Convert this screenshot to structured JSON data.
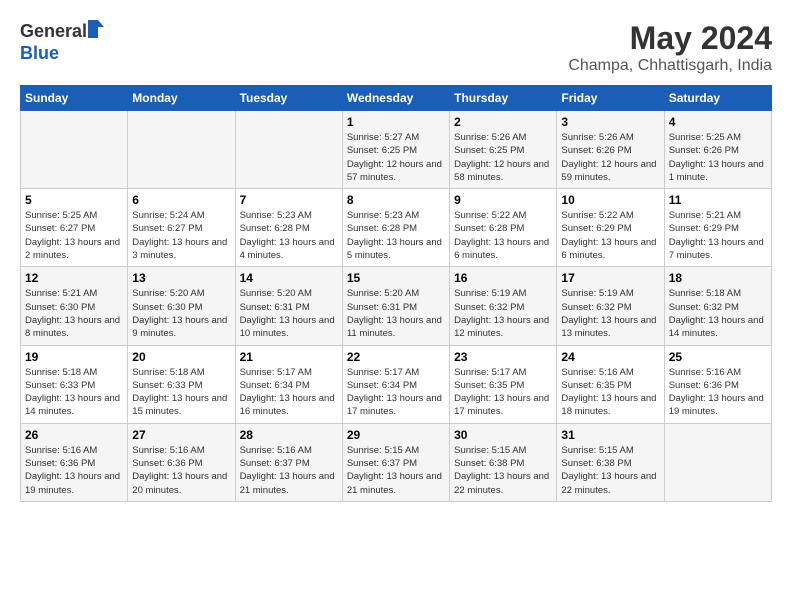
{
  "logo": {
    "general": "General",
    "blue": "Blue"
  },
  "title": {
    "month_year": "May 2024",
    "location": "Champa, Chhattisgarh, India"
  },
  "days_of_week": [
    "Sunday",
    "Monday",
    "Tuesday",
    "Wednesday",
    "Thursday",
    "Friday",
    "Saturday"
  ],
  "weeks": [
    [
      {
        "num": "",
        "sunrise": "",
        "sunset": "",
        "daylight": ""
      },
      {
        "num": "",
        "sunrise": "",
        "sunset": "",
        "daylight": ""
      },
      {
        "num": "",
        "sunrise": "",
        "sunset": "",
        "daylight": ""
      },
      {
        "num": "1",
        "sunrise": "Sunrise: 5:27 AM",
        "sunset": "Sunset: 6:25 PM",
        "daylight": "Daylight: 12 hours and 57 minutes."
      },
      {
        "num": "2",
        "sunrise": "Sunrise: 5:26 AM",
        "sunset": "Sunset: 6:25 PM",
        "daylight": "Daylight: 12 hours and 58 minutes."
      },
      {
        "num": "3",
        "sunrise": "Sunrise: 5:26 AM",
        "sunset": "Sunset: 6:26 PM",
        "daylight": "Daylight: 12 hours and 59 minutes."
      },
      {
        "num": "4",
        "sunrise": "Sunrise: 5:25 AM",
        "sunset": "Sunset: 6:26 PM",
        "daylight": "Daylight: 13 hours and 1 minute."
      }
    ],
    [
      {
        "num": "5",
        "sunrise": "Sunrise: 5:25 AM",
        "sunset": "Sunset: 6:27 PM",
        "daylight": "Daylight: 13 hours and 2 minutes."
      },
      {
        "num": "6",
        "sunrise": "Sunrise: 5:24 AM",
        "sunset": "Sunset: 6:27 PM",
        "daylight": "Daylight: 13 hours and 3 minutes."
      },
      {
        "num": "7",
        "sunrise": "Sunrise: 5:23 AM",
        "sunset": "Sunset: 6:28 PM",
        "daylight": "Daylight: 13 hours and 4 minutes."
      },
      {
        "num": "8",
        "sunrise": "Sunrise: 5:23 AM",
        "sunset": "Sunset: 6:28 PM",
        "daylight": "Daylight: 13 hours and 5 minutes."
      },
      {
        "num": "9",
        "sunrise": "Sunrise: 5:22 AM",
        "sunset": "Sunset: 6:28 PM",
        "daylight": "Daylight: 13 hours and 6 minutes."
      },
      {
        "num": "10",
        "sunrise": "Sunrise: 5:22 AM",
        "sunset": "Sunset: 6:29 PM",
        "daylight": "Daylight: 13 hours and 6 minutes."
      },
      {
        "num": "11",
        "sunrise": "Sunrise: 5:21 AM",
        "sunset": "Sunset: 6:29 PM",
        "daylight": "Daylight: 13 hours and 7 minutes."
      }
    ],
    [
      {
        "num": "12",
        "sunrise": "Sunrise: 5:21 AM",
        "sunset": "Sunset: 6:30 PM",
        "daylight": "Daylight: 13 hours and 8 minutes."
      },
      {
        "num": "13",
        "sunrise": "Sunrise: 5:20 AM",
        "sunset": "Sunset: 6:30 PM",
        "daylight": "Daylight: 13 hours and 9 minutes."
      },
      {
        "num": "14",
        "sunrise": "Sunrise: 5:20 AM",
        "sunset": "Sunset: 6:31 PM",
        "daylight": "Daylight: 13 hours and 10 minutes."
      },
      {
        "num": "15",
        "sunrise": "Sunrise: 5:20 AM",
        "sunset": "Sunset: 6:31 PM",
        "daylight": "Daylight: 13 hours and 11 minutes."
      },
      {
        "num": "16",
        "sunrise": "Sunrise: 5:19 AM",
        "sunset": "Sunset: 6:32 PM",
        "daylight": "Daylight: 13 hours and 12 minutes."
      },
      {
        "num": "17",
        "sunrise": "Sunrise: 5:19 AM",
        "sunset": "Sunset: 6:32 PM",
        "daylight": "Daylight: 13 hours and 13 minutes."
      },
      {
        "num": "18",
        "sunrise": "Sunrise: 5:18 AM",
        "sunset": "Sunset: 6:32 PM",
        "daylight": "Daylight: 13 hours and 14 minutes."
      }
    ],
    [
      {
        "num": "19",
        "sunrise": "Sunrise: 5:18 AM",
        "sunset": "Sunset: 6:33 PM",
        "daylight": "Daylight: 13 hours and 14 minutes."
      },
      {
        "num": "20",
        "sunrise": "Sunrise: 5:18 AM",
        "sunset": "Sunset: 6:33 PM",
        "daylight": "Daylight: 13 hours and 15 minutes."
      },
      {
        "num": "21",
        "sunrise": "Sunrise: 5:17 AM",
        "sunset": "Sunset: 6:34 PM",
        "daylight": "Daylight: 13 hours and 16 minutes."
      },
      {
        "num": "22",
        "sunrise": "Sunrise: 5:17 AM",
        "sunset": "Sunset: 6:34 PM",
        "daylight": "Daylight: 13 hours and 17 minutes."
      },
      {
        "num": "23",
        "sunrise": "Sunrise: 5:17 AM",
        "sunset": "Sunset: 6:35 PM",
        "daylight": "Daylight: 13 hours and 17 minutes."
      },
      {
        "num": "24",
        "sunrise": "Sunrise: 5:16 AM",
        "sunset": "Sunset: 6:35 PM",
        "daylight": "Daylight: 13 hours and 18 minutes."
      },
      {
        "num": "25",
        "sunrise": "Sunrise: 5:16 AM",
        "sunset": "Sunset: 6:36 PM",
        "daylight": "Daylight: 13 hours and 19 minutes."
      }
    ],
    [
      {
        "num": "26",
        "sunrise": "Sunrise: 5:16 AM",
        "sunset": "Sunset: 6:36 PM",
        "daylight": "Daylight: 13 hours and 19 minutes."
      },
      {
        "num": "27",
        "sunrise": "Sunrise: 5:16 AM",
        "sunset": "Sunset: 6:36 PM",
        "daylight": "Daylight: 13 hours and 20 minutes."
      },
      {
        "num": "28",
        "sunrise": "Sunrise: 5:16 AM",
        "sunset": "Sunset: 6:37 PM",
        "daylight": "Daylight: 13 hours and 21 minutes."
      },
      {
        "num": "29",
        "sunrise": "Sunrise: 5:15 AM",
        "sunset": "Sunset: 6:37 PM",
        "daylight": "Daylight: 13 hours and 21 minutes."
      },
      {
        "num": "30",
        "sunrise": "Sunrise: 5:15 AM",
        "sunset": "Sunset: 6:38 PM",
        "daylight": "Daylight: 13 hours and 22 minutes."
      },
      {
        "num": "31",
        "sunrise": "Sunrise: 5:15 AM",
        "sunset": "Sunset: 6:38 PM",
        "daylight": "Daylight: 13 hours and 22 minutes."
      },
      {
        "num": "",
        "sunrise": "",
        "sunset": "",
        "daylight": ""
      }
    ]
  ]
}
